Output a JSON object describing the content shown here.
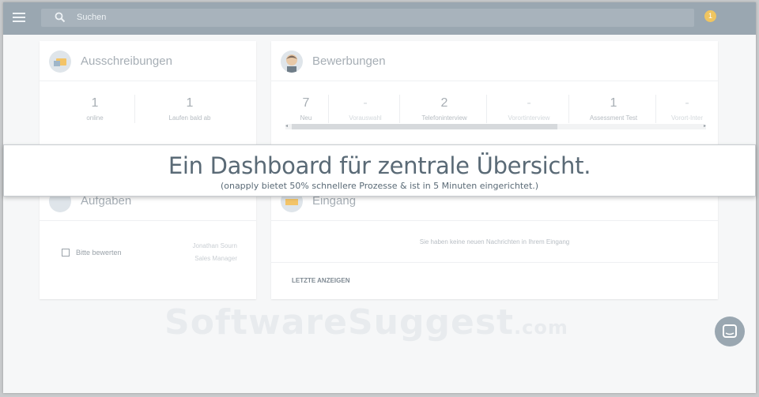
{
  "topbar": {
    "search_label": "Suchen",
    "notification_count": "1"
  },
  "ausschreibungen": {
    "title": "Ausschreibungen",
    "stats": [
      {
        "value": "1",
        "label": "online"
      },
      {
        "value": "1",
        "label": "Laufen bald ab"
      }
    ]
  },
  "bewerbungen": {
    "title": "Bewerbungen",
    "stats": [
      {
        "value": "7",
        "label": "Neu"
      },
      {
        "value": "-",
        "label": "Vorauswahl"
      },
      {
        "value": "2",
        "label": "Telefoninterview"
      },
      {
        "value": "-",
        "label": "Vorortinterview"
      },
      {
        "value": "1",
        "label": "Assessment Test"
      },
      {
        "value": "-",
        "label": "Vorort-Inter"
      }
    ]
  },
  "banner": {
    "title": "Ein Dashboard für zentrale Übersicht.",
    "subtitle": "(onapply bietet 50% schnellere Prozesse & ist in 5 Minuten eingerichtet.)"
  },
  "aufgaben": {
    "title": "Aufgaben",
    "task_label": "Bitte bewerten",
    "assignee_name": "Jonathan Sourn",
    "assignee_role": "Sales Manager"
  },
  "eingang": {
    "title": "Eingang",
    "empty_message": "Sie haben keine neuen Nachrichten in Ihrem Eingang",
    "show_latest": "LETZTE ANZEIGEN"
  },
  "watermark": {
    "brand": "SoftwareSuggest",
    "suffix": ".com"
  },
  "colors": {
    "topbar": "#9aa7b1",
    "accent_badge": "#f0c560",
    "banner_text": "#5a6a76"
  }
}
